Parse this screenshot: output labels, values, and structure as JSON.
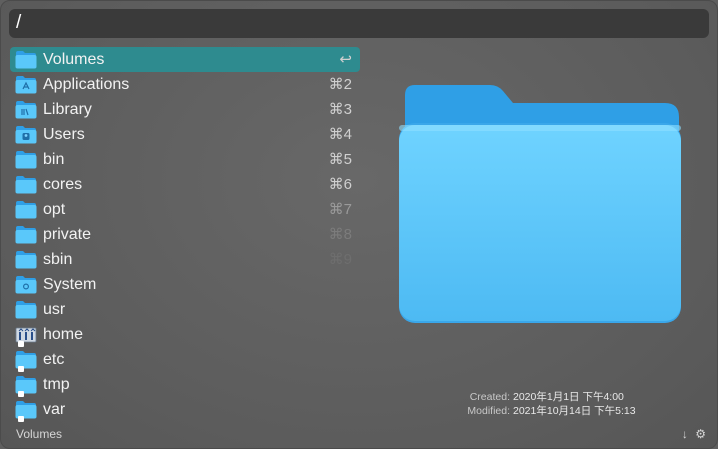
{
  "search": {
    "query": "/"
  },
  "results": [
    {
      "name": "Volumes",
      "shortcut": "↩",
      "icon": "folder-icon"
    },
    {
      "name": "Applications",
      "shortcut": "⌘2",
      "icon": "applications-folder-icon"
    },
    {
      "name": "Library",
      "shortcut": "⌘3",
      "icon": "library-folder-icon"
    },
    {
      "name": "Users",
      "shortcut": "⌘4",
      "icon": "users-folder-icon"
    },
    {
      "name": "bin",
      "shortcut": "⌘5",
      "icon": "folder-icon"
    },
    {
      "name": "cores",
      "shortcut": "⌘6",
      "icon": "folder-icon"
    },
    {
      "name": "opt",
      "shortcut": "⌘7",
      "icon": "folder-icon"
    },
    {
      "name": "private",
      "shortcut": "⌘8",
      "icon": "folder-icon"
    },
    {
      "name": "sbin",
      "shortcut": "⌘9",
      "icon": "folder-icon"
    },
    {
      "name": "System",
      "shortcut": "",
      "icon": "system-folder-icon"
    },
    {
      "name": "usr",
      "shortcut": "",
      "icon": "folder-icon"
    },
    {
      "name": "home",
      "shortcut": "",
      "icon": "network-home-icon"
    },
    {
      "name": "etc",
      "shortcut": "",
      "icon": "alias-folder-icon"
    },
    {
      "name": "tmp",
      "shortcut": "",
      "icon": "alias-folder-icon"
    },
    {
      "name": "var",
      "shortcut": "",
      "icon": "alias-folder-icon"
    }
  ],
  "preview": {
    "icon": "large-folder-icon",
    "created_label": "Created:",
    "created_value": "2020年1月1日 下午4:00",
    "modified_label": "Modified:",
    "modified_value": "2021年10月14日 下午5:13"
  },
  "footer": {
    "selected_name": "Volumes",
    "icons": [
      "download-arrow-icon",
      "gear-icon"
    ],
    "download_glyph": "↓",
    "gear_glyph": "⚙"
  },
  "colors": {
    "selection": "#2e8b8f",
    "folder_blue": "#5ac8fa"
  }
}
